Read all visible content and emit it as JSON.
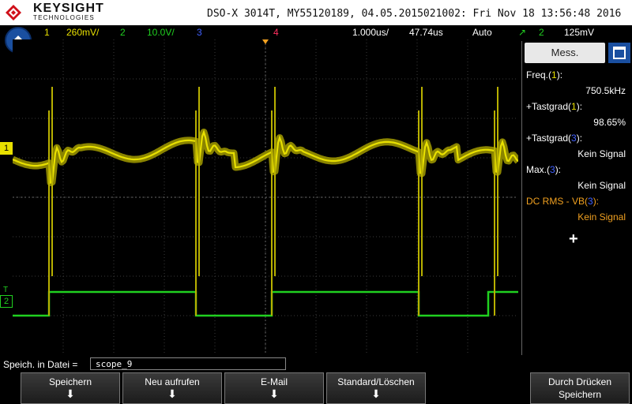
{
  "header": {
    "brand": "KEYSIGHT",
    "brand_sub": "TECHNOLOGIES",
    "device_info": "DSO-X 3014T, MY55120189, 04.05.2015021002: Fri Nov 18 13:56:48 2016"
  },
  "channels": {
    "ch1_num": "1",
    "ch1_scale": "260mV/",
    "ch2_num": "2",
    "ch2_scale": "10.0V/",
    "ch3_num": "3",
    "ch4_num": "4",
    "timebase": "1.000us/",
    "delay": "47.74us",
    "trigger_mode": "Auto",
    "trigger_source": "2",
    "trigger_level": "125mV",
    "colors": {
      "ch1": "#e8e000",
      "ch2": "#20d020",
      "ch3": "#4060ff",
      "ch4": "#ff3060"
    }
  },
  "markers": {
    "ch1": "1",
    "ch2": "2",
    "trigger": "T"
  },
  "panel": {
    "tab_label": "Mess.",
    "measurements": [
      {
        "label_pre": "Freq.(",
        "ch": "1",
        "label_post": "):",
        "value": "750.5kHz",
        "highlight": false
      },
      {
        "label_pre": "+Tastgrad(",
        "ch": "1",
        "label_post": "):",
        "value": "98.65%",
        "highlight": false
      },
      {
        "label_pre": "+Tastgrad(",
        "ch": "3",
        "label_post": "):",
        "value": "Kein Signal",
        "highlight": false
      },
      {
        "label_pre": "Max.(",
        "ch": "3",
        "label_post": "):",
        "value": "Kein Signal",
        "highlight": false
      },
      {
        "label_pre": "DC RMS - VB(",
        "ch": "3",
        "label_post": "):",
        "value": "Kein Signal",
        "highlight": true
      }
    ],
    "add_symbol": "+"
  },
  "status": {
    "label": "Speich. in Datei =",
    "filename": "scope_9"
  },
  "softkeys": {
    "up_symbol": "⬆",
    "save": "Speichern",
    "refresh": "Neu aufrufen",
    "email": "E-Mail",
    "default_clear": "Standard/Löschen",
    "print_line1": "Durch Drücken",
    "print_line2": "Speichern",
    "arrow": "⬇"
  }
}
